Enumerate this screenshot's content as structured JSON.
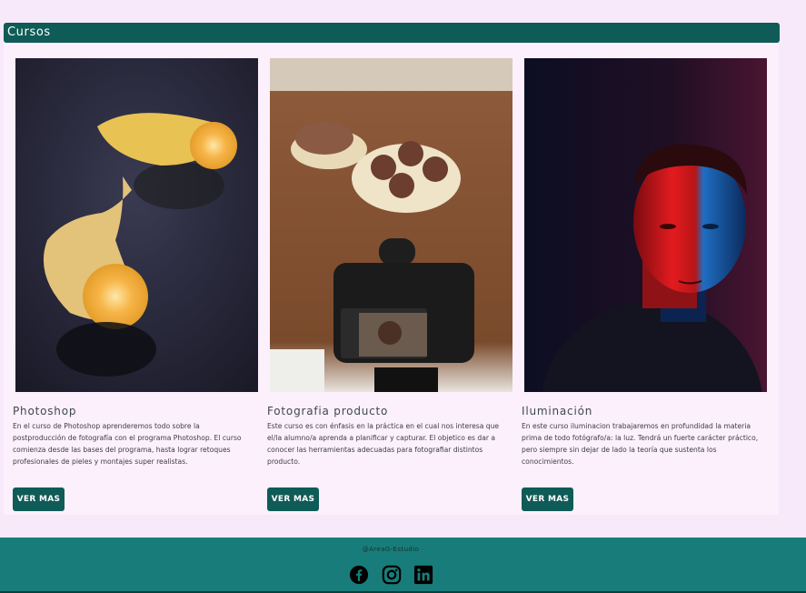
{
  "section": {
    "title": "Cursos"
  },
  "courses": [
    {
      "title": "Photoshop",
      "description": "En el curso de Photoshop aprenderemos todo sobre la postproducción de fotografía con el programa Photoshop. El curso comienza desde las bases del programa, hasta lograr retoques profesionales de pieles y montajes super realistas.",
      "button_label": "VER MAS",
      "image": "banana-halves-photo"
    },
    {
      "title": "Fotografia producto",
      "description": "Este curso es con énfasis en la práctica en el cual nos interesa que el/la alumno/a aprenda a planificar y capturar. El objetico es dar a conocer las herramientas adecuadas para fotografiar distintos producto.",
      "button_label": "VER MAS",
      "image": "camera-shooting-cookies-photo"
    },
    {
      "title": "Iluminación",
      "description": "En este curso iluminacion trabajaremos en profundidad la materia prima de todo fotógrafo/a: la luz. Tendrá un fuerte carácter práctico, pero siempre sin dejar de lado la teoría que sustenta los conocimientos.",
      "button_label": "VER MAS",
      "image": "red-blue-lit-portrait-photo"
    }
  ],
  "footer": {
    "credit": "@AreaG-Estudio",
    "social": [
      "facebook-icon",
      "instagram-icon",
      "linkedin-icon"
    ]
  },
  "colors": {
    "page_bg": "#f8e9fa",
    "accent": "#0f5b57",
    "footer_bg": "#187d7a"
  }
}
